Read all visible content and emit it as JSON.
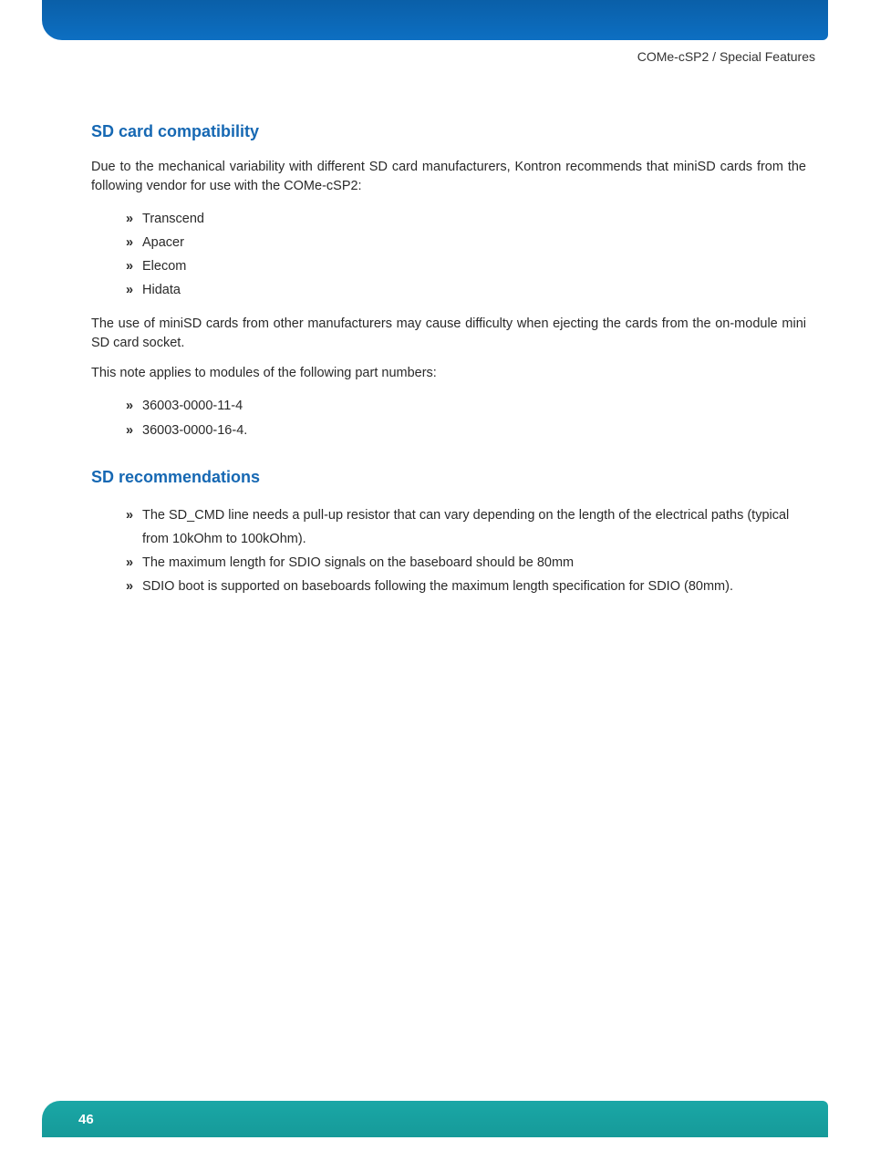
{
  "header": {
    "breadcrumb": "COMe-cSP2 / Special Features"
  },
  "sections": {
    "sd_compat": {
      "title": "SD card compatibility",
      "para1": "Due to the mechanical variability with different SD card manufacturers, Kontron recommends that miniSD cards from the following vendor for use with the COMe-cSP2:",
      "vendors": {
        "0": "Transcend",
        "1": "Apacer",
        "2": "Elecom",
        "3": "Hidata"
      },
      "para2": "The use of miniSD cards from other manufacturers may cause difficulty when ejecting the cards from the on-module mini SD card socket.",
      "para3": "This note applies to modules of the following part numbers:",
      "parts": {
        "0": "36003-0000-11-4",
        "1": "36003-0000-16-4."
      }
    },
    "sd_rec": {
      "title": "SD recommendations",
      "items": {
        "0": "The SD_CMD line needs a pull-up resistor that can vary depending on the length of the electrical paths (typical from 10kOhm to 100kOhm).",
        "1": "The maximum length for SDIO signals on the baseboard should be 80mm",
        "2": "SDIO boot is supported on baseboards following the maximum length specification for SDIO (80mm)."
      }
    }
  },
  "footer": {
    "page_number": "46"
  }
}
